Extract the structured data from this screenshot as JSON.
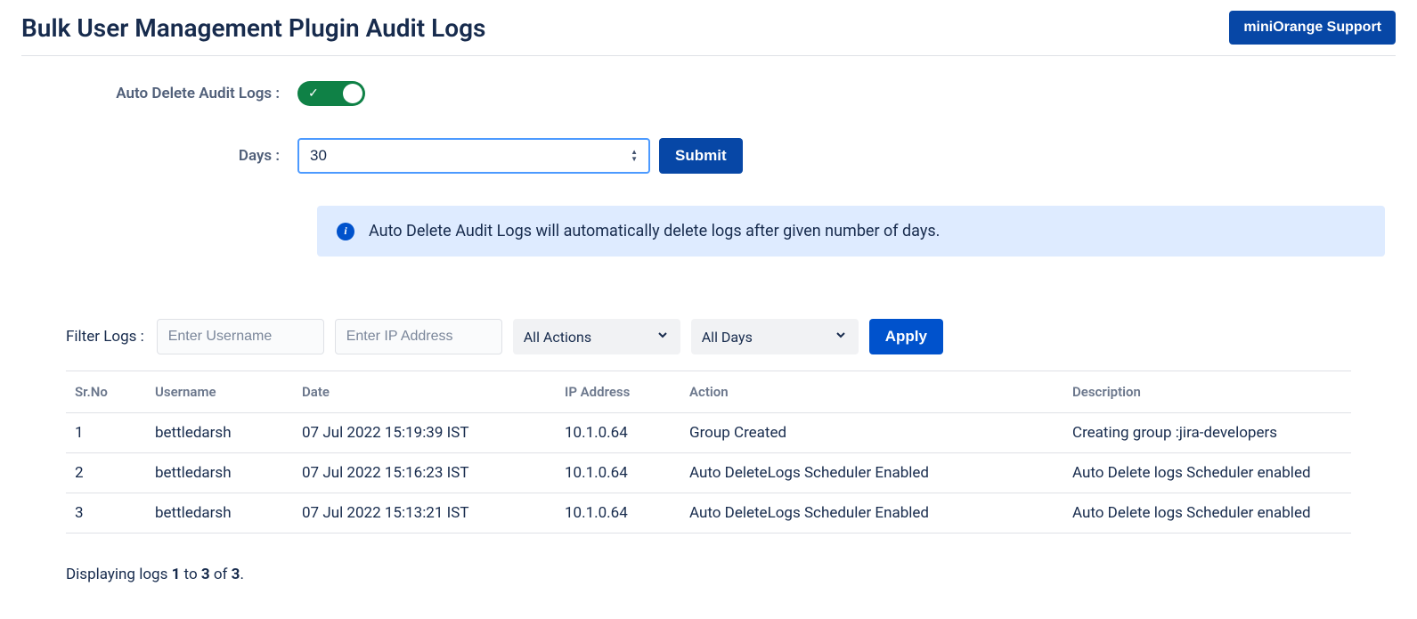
{
  "header": {
    "title": "Bulk User Management Plugin Audit Logs",
    "support_button": "miniOrange Support"
  },
  "autoDelete": {
    "label": "Auto Delete Audit Logs :",
    "enabled": true,
    "days_label": "Days :",
    "days_value": "30",
    "submit_label": "Submit",
    "info_text": "Auto Delete Audit Logs will automatically delete logs after given number of days."
  },
  "filter": {
    "label": "Filter Logs :",
    "username_placeholder": "Enter Username",
    "ip_placeholder": "Enter IP Address",
    "actions_selected": "All Actions",
    "days_selected": "All Days",
    "apply_label": "Apply"
  },
  "table": {
    "headers": {
      "srno": "Sr.No",
      "username": "Username",
      "date": "Date",
      "ip": "IP Address",
      "action": "Action",
      "description": "Description"
    },
    "rows": [
      {
        "srno": "1",
        "username": "bettledarsh",
        "date": "07 Jul 2022 15:19:39 IST",
        "ip": "10.1.0.64",
        "action": "Group Created",
        "description": "Creating group :jira-developers"
      },
      {
        "srno": "2",
        "username": "bettledarsh",
        "date": "07 Jul 2022 15:16:23 IST",
        "ip": "10.1.0.64",
        "action": "Auto DeleteLogs Scheduler Enabled",
        "description": "Auto Delete logs Scheduler enabled"
      },
      {
        "srno": "3",
        "username": "bettledarsh",
        "date": "07 Jul 2022 15:13:21 IST",
        "ip": "10.1.0.64",
        "action": "Auto DeleteLogs Scheduler Enabled",
        "description": "Auto Delete logs Scheduler enabled"
      }
    ]
  },
  "pagination": {
    "prefix": "Displaying logs ",
    "from": "1",
    "mid": " to ",
    "to": "3",
    "of_text": " of ",
    "total": "3",
    "suffix": "."
  }
}
